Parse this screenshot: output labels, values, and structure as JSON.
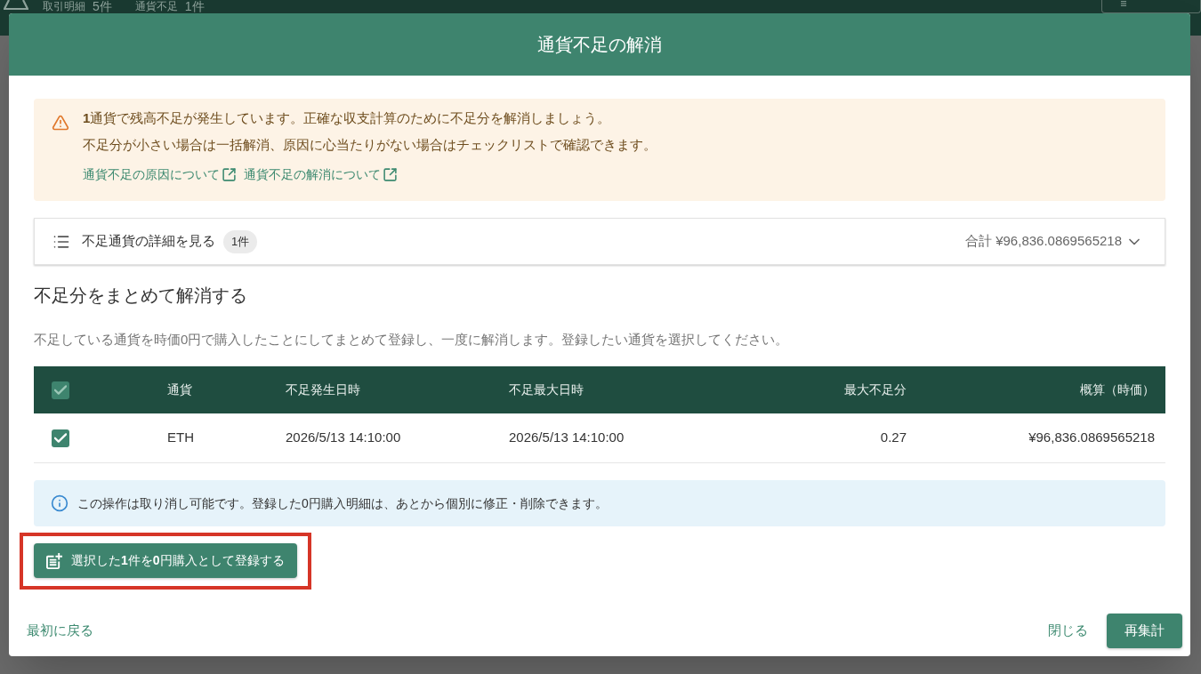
{
  "background_page": {
    "header": {
      "items": [
        {
          "label": "取引明細",
          "count": "5件"
        },
        {
          "label": "通貨不足",
          "count": "1件"
        }
      ]
    }
  },
  "dialog": {
    "title": "通貨不足の解消",
    "warning": {
      "lines": [
        "**1**通貨で残高不足が発生しています。正確な収支計算のために不足分を解消しましょう。",
        "不足分が小さい場合は一括解消、原因に心当たりがない場合はチェックリストで確認できます。"
      ],
      "links": [
        "通貨不足の原因について",
        "通貨不足の解消について"
      ]
    },
    "details": {
      "label": "不足通貨の詳細を見る",
      "count": "1件",
      "total": "合計 ¥96,836.0869565218",
      "expanded": false
    },
    "bulk_section": {
      "heading": "不足分をまとめて解消する",
      "description": "不足している通貨を時価0円で購入したことにしてまとめて登録し、一度に解消します。登録したい通貨を選択してください。",
      "table": {
        "select_all_checked": true,
        "columns": [
          "通貨",
          "不足発生日時",
          "不足最大日時",
          "最大不足分",
          "概算（時価）"
        ],
        "rows": [
          {
            "checked": true,
            "cells": [
              "ETH",
              "2026/5/13 14:10:00",
              "2026/5/13 14:10:00",
              "0.27",
              "¥96,836.0869565218"
            ]
          }
        ]
      },
      "info": "この操作は取り消し可能です。登録した0円購入明細は、あとから個別に修正・削除できます。",
      "register_button": {
        "label": "選択した**1**件を**0**円購入として登録する",
        "highlighted": true
      }
    },
    "footer": {
      "back_link": "最初に戻る",
      "close_button": "閉じる",
      "recalc_button": "再集計"
    }
  }
}
